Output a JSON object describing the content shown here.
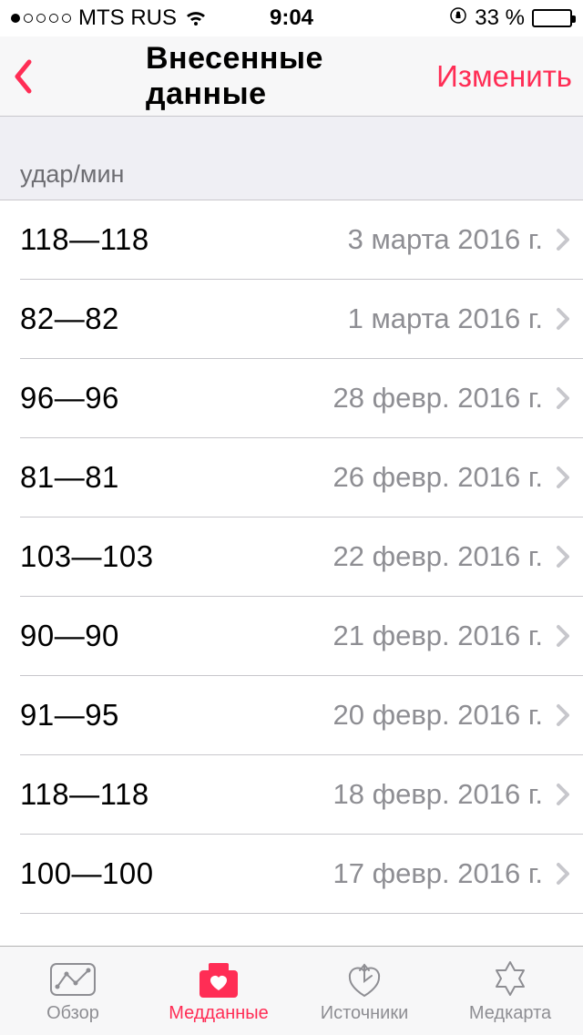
{
  "status": {
    "carrier": "MTS RUS",
    "time": "9:04",
    "battery_pct": "33 %"
  },
  "nav": {
    "title": "Внесенные данные",
    "edit": "Изменить"
  },
  "section_header": "удар/мин",
  "rows": [
    {
      "value": "118—118",
      "date": "3 марта 2016 г."
    },
    {
      "value": "82—82",
      "date": "1 марта 2016 г."
    },
    {
      "value": "96—96",
      "date": "28 февр. 2016 г."
    },
    {
      "value": "81—81",
      "date": "26 февр. 2016 г."
    },
    {
      "value": "103—103",
      "date": "22 февр. 2016 г."
    },
    {
      "value": "90—90",
      "date": "21 февр. 2016 г."
    },
    {
      "value": "91—95",
      "date": "20 февр. 2016 г."
    },
    {
      "value": "118—118",
      "date": "18 февр. 2016 г."
    },
    {
      "value": "100—100",
      "date": "17 февр. 2016 г."
    }
  ],
  "tabs": [
    {
      "label": "Обзор"
    },
    {
      "label": "Медданные"
    },
    {
      "label": "Источники"
    },
    {
      "label": "Медкарта"
    }
  ],
  "colors": {
    "accent": "#ff2d55",
    "muted": "#8e8e93"
  }
}
